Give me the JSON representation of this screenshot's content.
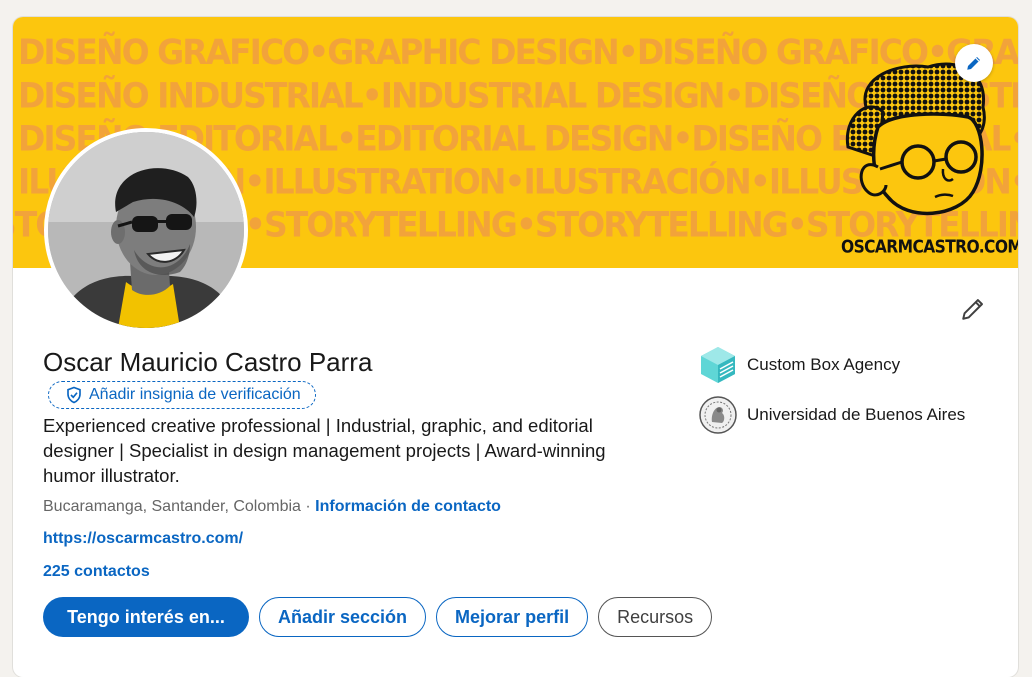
{
  "banner": {
    "pattern_lines": [
      "DISEÑO GRAFICO•GRAPHIC DESIGN•DISEÑO GRAFICO•GRAPHIC DESIGN•DISEÑO GRAFICO",
      "DISEÑO INDUSTRIAL•INDUSTRIAL DESIGN•DISEÑO INDUSTRIAL•INDUSTRIAL DESIGN",
      "DISEÑO EDITORIAL•EDITORIAL DESIGN•DISEÑO EDITORIAL•EDITORIAL DESIGN",
      "ILUSTRACIÓN•ILLUSTRATION•ILUSTRACIÓN•ILLUSTRATION•ILUSTRACIÓN•ILLUSTRATION",
      "STORYTELLING•STORYTELLING•STORYTELLING•STORYTELLING•STORYTELLING•STORYTELLING"
    ],
    "brand_url": "OSCARMCASTRO.COM",
    "background_color": "#fcc60e",
    "pattern_color": "#f2a33a",
    "edit_icon": "pencil-icon"
  },
  "profile": {
    "name": "Oscar Mauricio Castro Parra",
    "verify_badge": "Añadir insignia de verificación",
    "headline": "Experienced creative professional | Industrial, graphic, and editorial designer | Specialist in design management projects | Award-winning humor illustrator.",
    "location": "Bucaramanga, Santander, Colombia",
    "separator": " · ",
    "contact_info": "Información de contacto",
    "website": "https://oscarmcastro.com/",
    "connections": "225 contactos"
  },
  "orgs": [
    {
      "name": "Custom Box Agency",
      "icon": "custom-box-logo"
    },
    {
      "name": "Universidad de Buenos Aires",
      "icon": "uba-seal-logo"
    }
  ],
  "actions": {
    "open_to": "Tengo interés en...",
    "add_section": "Añadir sección",
    "enhance_profile": "Mejorar perfil",
    "resources": "Recursos"
  },
  "colors": {
    "accent": "#0a66c2",
    "text": "#191919",
    "muted": "#666666"
  }
}
